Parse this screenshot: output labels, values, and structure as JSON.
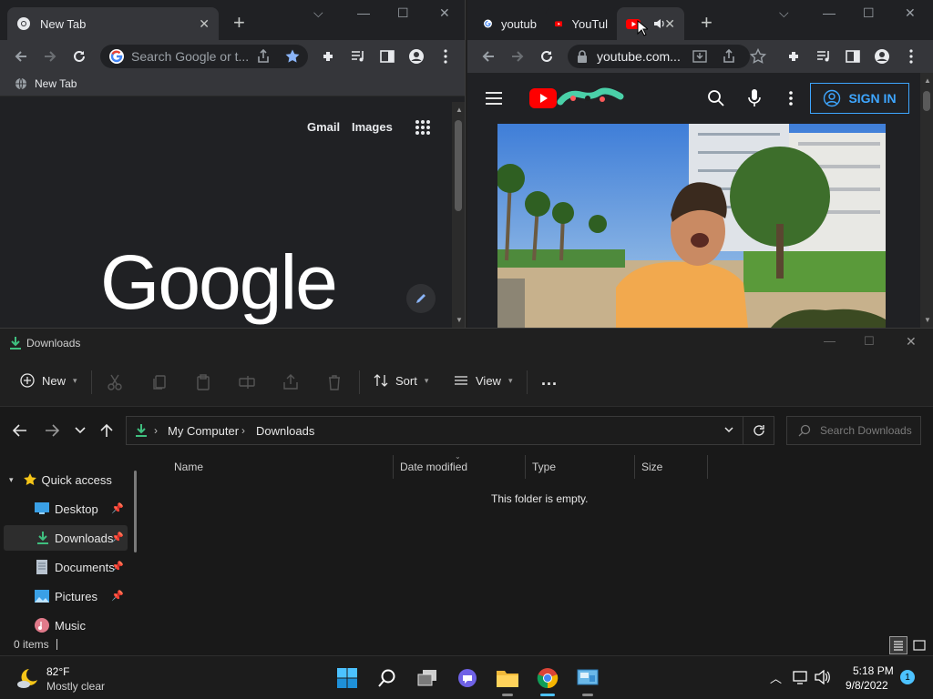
{
  "left_chrome": {
    "tab_title": "New Tab",
    "omnibox_placeholder": "Search Google or t...",
    "bookmark_label": "New Tab",
    "ntp_links": [
      "Gmail",
      "Images"
    ],
    "logo_text": "Google"
  },
  "right_chrome": {
    "tabs": [
      {
        "title": "youtub",
        "icon": "google-icon"
      },
      {
        "title": "YouTul",
        "icon": "youtube-icon"
      },
      {
        "title": "",
        "icon": "youtube-icon"
      }
    ],
    "url": "youtube.com...",
    "signin_label": "SIGN IN"
  },
  "explorer": {
    "title": "Downloads",
    "commands": {
      "new_label": "New",
      "sort_label": "Sort",
      "view_label": "View",
      "more_label": "..."
    },
    "breadcrumb": [
      "My Computer",
      "Downloads"
    ],
    "search_placeholder": "Search Downloads",
    "nav": [
      {
        "label": "Quick access",
        "icon": "star-icon"
      },
      {
        "label": "Desktop",
        "icon": "desktop-icon"
      },
      {
        "label": "Downloads",
        "icon": "download-icon"
      },
      {
        "label": "Documents",
        "icon": "document-icon"
      },
      {
        "label": "Pictures",
        "icon": "pictures-icon"
      },
      {
        "label": "Music",
        "icon": "music-icon"
      }
    ],
    "columns": [
      "Name",
      "Date modified",
      "Type",
      "Size"
    ],
    "empty_message": "This folder is empty.",
    "status_text": "0 items"
  },
  "taskbar": {
    "weather_temp": "82°F",
    "weather_desc": "Mostly clear",
    "time": "5:18 PM",
    "date": "9/8/2022",
    "notification_count": "1"
  }
}
